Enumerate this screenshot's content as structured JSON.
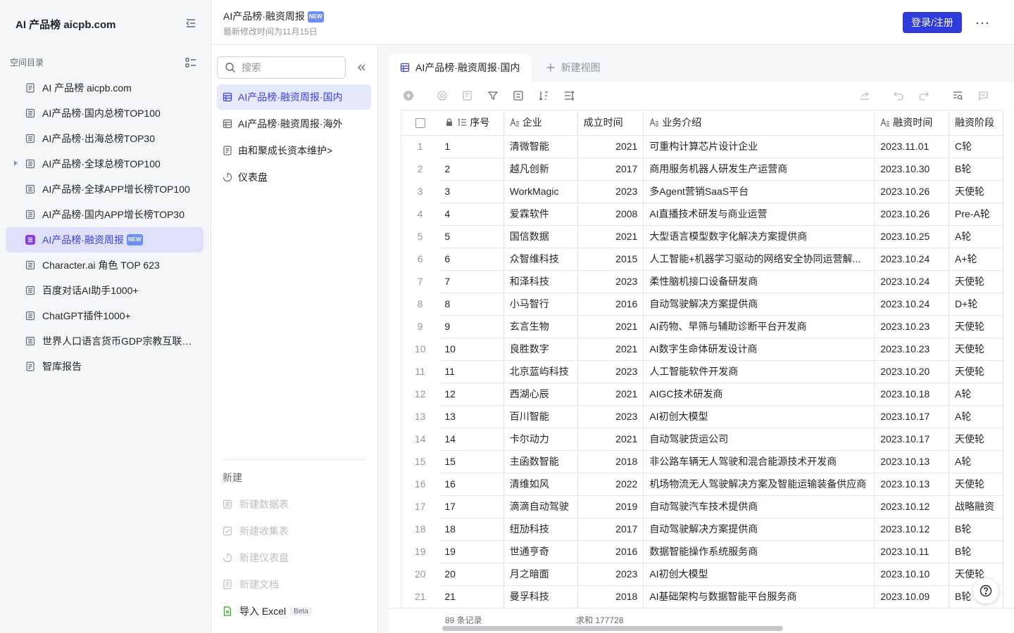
{
  "sidebar": {
    "brand": "AI 产品榜 aicpb.com",
    "section_title": "空间目录",
    "items": [
      {
        "label": "AI 产品榜 aicpb.com",
        "icon": "doc-icon"
      },
      {
        "label": "AI产品榜·国内总榜TOP100",
        "icon": "table-icon"
      },
      {
        "label": "AI产品榜·出海总榜TOP30",
        "icon": "table-icon"
      },
      {
        "label": "AI产品榜·全球总榜TOP100",
        "icon": "table-icon",
        "expandable": true
      },
      {
        "label": "AI产品榜·全球APP增长榜TOP100",
        "icon": "table-icon"
      },
      {
        "label": "AI产品榜·国内APP增长榜TOP30",
        "icon": "table-icon"
      },
      {
        "label": "AI产品榜·融资周报",
        "icon": "table-icon",
        "active": true,
        "badge": "NEW"
      },
      {
        "label": "Character.ai 角色 TOP 623",
        "icon": "table-icon"
      },
      {
        "label": "百度对话AI助手1000+",
        "icon": "table-icon"
      },
      {
        "label": "ChatGPT插件1000+",
        "icon": "table-icon"
      },
      {
        "label": "世界人口语言货币GDP宗教互联网...",
        "icon": "table-icon"
      },
      {
        "label": "智库报告",
        "icon": "doc-icon"
      }
    ]
  },
  "header": {
    "title": "AI产品榜·融资周报",
    "title_badge": "NEW",
    "subtitle": "最新修改时间为11月15日",
    "login_label": "登录/注册",
    "more_label": "···"
  },
  "panel": {
    "search_placeholder": "搜索",
    "views": [
      {
        "label": "AI产品榜·融资周报·国内",
        "icon": "grid-view-icon",
        "active": true
      },
      {
        "label": "AI产品榜·融资周报·海外",
        "icon": "grid-view-icon"
      },
      {
        "label": "由和聚成长资本维护>",
        "icon": "doc-icon"
      },
      {
        "label": "仪表盘",
        "icon": "dashboard-icon"
      }
    ],
    "new_title": "新建",
    "new_items": [
      {
        "label": "新建数据表",
        "icon": "table-icon"
      },
      {
        "label": "新建收集表",
        "icon": "form-icon"
      },
      {
        "label": "新建仪表盘",
        "icon": "dashboard-icon"
      },
      {
        "label": "新建文档",
        "icon": "doc-icon"
      },
      {
        "label": "导入 Excel",
        "icon": "excel-icon",
        "badge": "Beta"
      }
    ]
  },
  "tabs": {
    "active": "AI产品榜·融资周报·国内",
    "add": "新建视图"
  },
  "table": {
    "columns": [
      "序号",
      "企业",
      "成立时间",
      "业务介绍",
      "融资时间",
      "融资阶段"
    ],
    "rows": [
      [
        "1",
        "1",
        "清微智能",
        "2021",
        "可重构计算芯片设计企业",
        "2023.11.01",
        "C轮"
      ],
      [
        "2",
        "2",
        "越凡创新",
        "2017",
        "商用服务机器人研发生产运营商",
        "2023.10.30",
        "B轮"
      ],
      [
        "3",
        "3",
        "WorkMagic",
        "2023",
        "多Agent营销SaaS平台",
        "2023.10.26",
        "天使轮"
      ],
      [
        "4",
        "4",
        "爱霖软件",
        "2008",
        "AI直播技术研发与商业运营",
        "2023.10.26",
        "Pre-A轮"
      ],
      [
        "5",
        "5",
        "国信数据",
        "2021",
        "大型语言模型数字化解决方案提供商",
        "2023.10.25",
        "A轮"
      ],
      [
        "6",
        "6",
        "众智维科技",
        "2015",
        "人工智能+机器学习驱动的网络安全协同运营解...",
        "2023.10.24",
        "A+轮"
      ],
      [
        "7",
        "7",
        "和泽科技",
        "2023",
        "柔性脑机接口设备研发商",
        "2023.10.24",
        "天使轮"
      ],
      [
        "8",
        "8",
        "小马智行",
        "2016",
        "自动驾驶解决方案提供商",
        "2023.10.24",
        "D+轮"
      ],
      [
        "9",
        "9",
        "玄言生物",
        "2021",
        "AI药物、早筛与辅助诊断平台开发商",
        "2023.10.23",
        "天使轮"
      ],
      [
        "10",
        "10",
        "良胜数字",
        "2021",
        "AI数字生命体研发设计商",
        "2023.10.23",
        "天使轮"
      ],
      [
        "11",
        "11",
        "北京蓝屿科技",
        "2023",
        "人工智能软件开发商",
        "2023.10.20",
        "天使轮"
      ],
      [
        "12",
        "12",
        "西湖心辰",
        "2021",
        "AIGC技术研发商",
        "2023.10.18",
        "A轮"
      ],
      [
        "13",
        "13",
        "百川智能",
        "2023",
        "AI初创大模型",
        "2023.10.17",
        "A轮"
      ],
      [
        "14",
        "14",
        "卡尔动力",
        "2021",
        "自动驾驶货运公司",
        "2023.10.17",
        "天使轮"
      ],
      [
        "15",
        "15",
        "主函数智能",
        "2018",
        "非公路车辆无人驾驶和混合能源技术开发商",
        "2023.10.13",
        "A轮"
      ],
      [
        "16",
        "16",
        "清维如风",
        "2022",
        "机场物流无人驾驶解决方案及智能运输装备供应商",
        "2023.10.13",
        "天使轮"
      ],
      [
        "17",
        "17",
        "滴滴自动驾驶",
        "2019",
        "自动驾驶汽车技术提供商",
        "2023.10.12",
        "战略融资"
      ],
      [
        "18",
        "18",
        "纽劢科技",
        "2017",
        "自动驾驶解决方案提供商",
        "2023.10.12",
        "B轮"
      ],
      [
        "19",
        "19",
        "世通亨奇",
        "2016",
        "数据智能操作系统服务商",
        "2023.10.11",
        "B轮"
      ],
      [
        "20",
        "20",
        "月之暗面",
        "2023",
        "AI初创大模型",
        "2023.10.10",
        "天使轮"
      ],
      [
        "21",
        "21",
        "曼孚科技",
        "2018",
        "AI基础架构与数据智能平台服务商",
        "2023.10.09",
        "B轮"
      ]
    ]
  },
  "footer": {
    "record_count": "89 条记录",
    "sum": "求和 177728"
  },
  "colors": {
    "accent": "#2e3ad9",
    "active_bg": "#dfe0f9",
    "badge_purple": "#8b3fe6"
  }
}
